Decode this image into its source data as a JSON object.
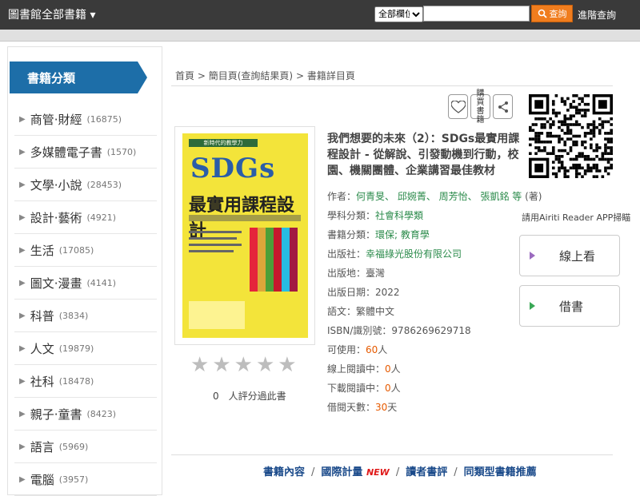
{
  "topbar": {
    "brand": "圖書館全部書籍",
    "field_selected": "全部欄位",
    "search_button": "查詢",
    "advanced": "進階查詢"
  },
  "sidebar": {
    "header": "書籍分類",
    "items": [
      {
        "label": "商管‧財經",
        "count": "(16875)"
      },
      {
        "label": "多媒體電子書",
        "count": "(1570)"
      },
      {
        "label": "文學‧小說",
        "count": "(28453)"
      },
      {
        "label": "設計‧藝術",
        "count": "(4921)"
      },
      {
        "label": "生活",
        "count": "(17085)"
      },
      {
        "label": "圖文‧漫畫",
        "count": "(4141)"
      },
      {
        "label": "科普",
        "count": "(3834)"
      },
      {
        "label": "人文",
        "count": "(19879)"
      },
      {
        "label": "社科",
        "count": "(18478)"
      },
      {
        "label": "親子‧童書",
        "count": "(8423)"
      },
      {
        "label": "語言",
        "count": "(5969)"
      },
      {
        "label": "電腦",
        "count": "(3957)"
      }
    ]
  },
  "breadcrumb": {
    "home": "首頁",
    "sep": ">",
    "list": "簡目頁(查詢結果頁)",
    "current": "書籍詳目頁"
  },
  "actions": {
    "buy_label": "購買書籍"
  },
  "cover": {
    "tag": "新時代的教學力",
    "big": "SDGs",
    "title": "最實用課程設計"
  },
  "rating": {
    "stars": 0,
    "text": "0　人評分過此書"
  },
  "book": {
    "title": "我們想要的未來（2）：SDGs最實用課程設計 - 從解說、引發動機到行動，校園、機關團體、企業講習最佳教材",
    "author_label": "作者：",
    "authors": "何青旻、 邱婉菁、 周芳怡、 張凱銘 等",
    "author_role": "(著)",
    "subject_label": "學科分類：",
    "subject": "社會科學類",
    "category_label": "書籍分類：",
    "category": "環保; 教育學",
    "publisher_label": "出版社：",
    "publisher": "幸福綠光股份有限公司",
    "place_label": "出版地：",
    "place": "臺灣",
    "date_label": "出版日期：",
    "date": "2022",
    "lang_label": "語文：",
    "lang": "繁體中文",
    "isbn_label": "ISBN/識別號：",
    "isbn": "9786269629718",
    "avail_label": "可使用：",
    "avail": "60",
    "avail_unit": "人",
    "online_label": "線上閱讀中：",
    "online": "0",
    "online_unit": "人",
    "download_label": "下載閱讀中：",
    "download": "0",
    "download_unit": "人",
    "loan_label": "借閱天數：",
    "loan": "30",
    "loan_unit": "天"
  },
  "qr": {
    "caption": "請用Airiti Reader APP掃瞄"
  },
  "buttons": {
    "read_online": "線上看",
    "borrow": "借書",
    "read_color": "#9b6bbf",
    "borrow_color": "#3aa856"
  },
  "bottom_nav": {
    "content": "書籍內容",
    "intl": "國際計量",
    "new_badge": "NEW",
    "reviews": "讀者書評",
    "similar": "同類型書籍推薦",
    "sep": "/"
  }
}
